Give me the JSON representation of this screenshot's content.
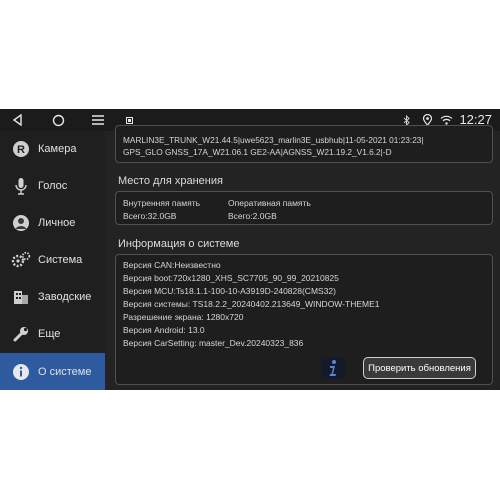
{
  "statusbar": {
    "time": "12:27",
    "icons": [
      "back-icon",
      "home-icon",
      "menu-icon",
      "app-badge-icon",
      "bluetooth-icon",
      "location-icon",
      "wifi-icon"
    ]
  },
  "sidebar": {
    "items": [
      {
        "label": "Камера",
        "icon": "camera-icon"
      },
      {
        "label": "Голос",
        "icon": "microphone-icon"
      },
      {
        "label": "Личное",
        "icon": "person-icon"
      },
      {
        "label": "Система",
        "icon": "gears-icon"
      },
      {
        "label": "Заводские",
        "icon": "building-icon"
      },
      {
        "label": "Еще",
        "icon": "wrench-icon"
      },
      {
        "label": "О системе",
        "icon": "info-icon",
        "active": true
      }
    ]
  },
  "top_panel": {
    "line1": "MARLIN3E_TRUNK_W21.44.5|uwe5623_marlin3E_usbhub|11-05-2021 01:23:23|",
    "line2": "GPS_GLO GNSS_17A_W21.06.1 GE2-AA|AGNSS_W21.19.2_V1.6.2|-D"
  },
  "storage": {
    "title": "Место для хранения",
    "internal_label": "Внутренняя память",
    "internal_value": "Всего:32.0GB",
    "ram_label": "Оперативная память",
    "ram_value": "Всего:2.0GB"
  },
  "system_info": {
    "title": "Информация о системе",
    "lines": [
      "Версия CAN:Неизвестно",
      "Версия  boot:720x1280_XHS_SC7705_90_99_20210825",
      "Версия MCU:Ts18.1.1-100-10-A3919D-240828(CMS32)",
      "Версия системы: TS18.2.2_20240402.213649_WINDOW-THEME1",
      "Разрешение экрана: 1280x720",
      "Версия Android: 13.0",
      "Версия CarSetting:  master_Dev.20240323_836"
    ],
    "update_button": "Проверить обновления"
  },
  "colors": {
    "active_item": "#2e5aa0",
    "background": "#232323"
  }
}
